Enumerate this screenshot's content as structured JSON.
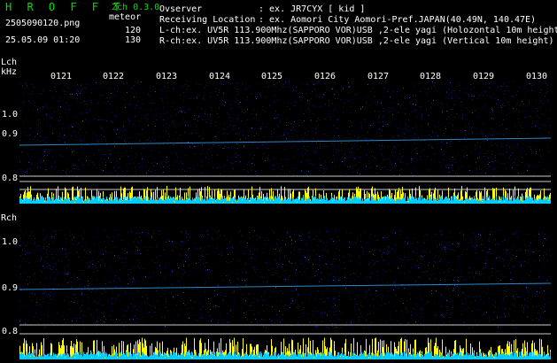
{
  "header": {
    "logo": "H R O F F T",
    "mode": "2ch 0.3.0",
    "filename": "2505090120.png",
    "type_label": "meteor",
    "datetime": "25.05.09 01:20",
    "count1": "120",
    "count2": "130",
    "observer_label": "Ovserver",
    "observer_value": ": ex. JR7CYX [ kid ]",
    "location_label": "Receiving Location",
    "location_value": ": ex. Aomori City Aomori-Pref.JAPAN(40.49N, 140.47E)",
    "lch_line": "L-ch:ex. UV5R 113.900Mhz(SAPPORO VOR)USB ,2-ele yagi (Holozontal 10m height)",
    "rch_line": "R-ch:ex. UV5R 113.900Mhz(SAPPORO VOR)USB ,2-ele yagi (Vertical 10m height)"
  },
  "lch": {
    "label": "Lch",
    "unit": "kHz",
    "yticks": [
      "1.0",
      "0.9",
      "0.8"
    ]
  },
  "rch": {
    "label": "Rch",
    "yticks": [
      "1.0",
      "0.9",
      "0.8"
    ]
  },
  "time_ticks": [
    "0121",
    "0122",
    "0123",
    "0124",
    "0125",
    "0126",
    "0127",
    "0128",
    "0129",
    "0130"
  ],
  "colors": {
    "background": "#000000",
    "spectrum_noise": "#1a1a80",
    "signal_line": "#33aaff",
    "amplitude_yellow": "#ffff00",
    "amplitude_cyan": "#00ccff",
    "text_green": "#00e000"
  }
}
